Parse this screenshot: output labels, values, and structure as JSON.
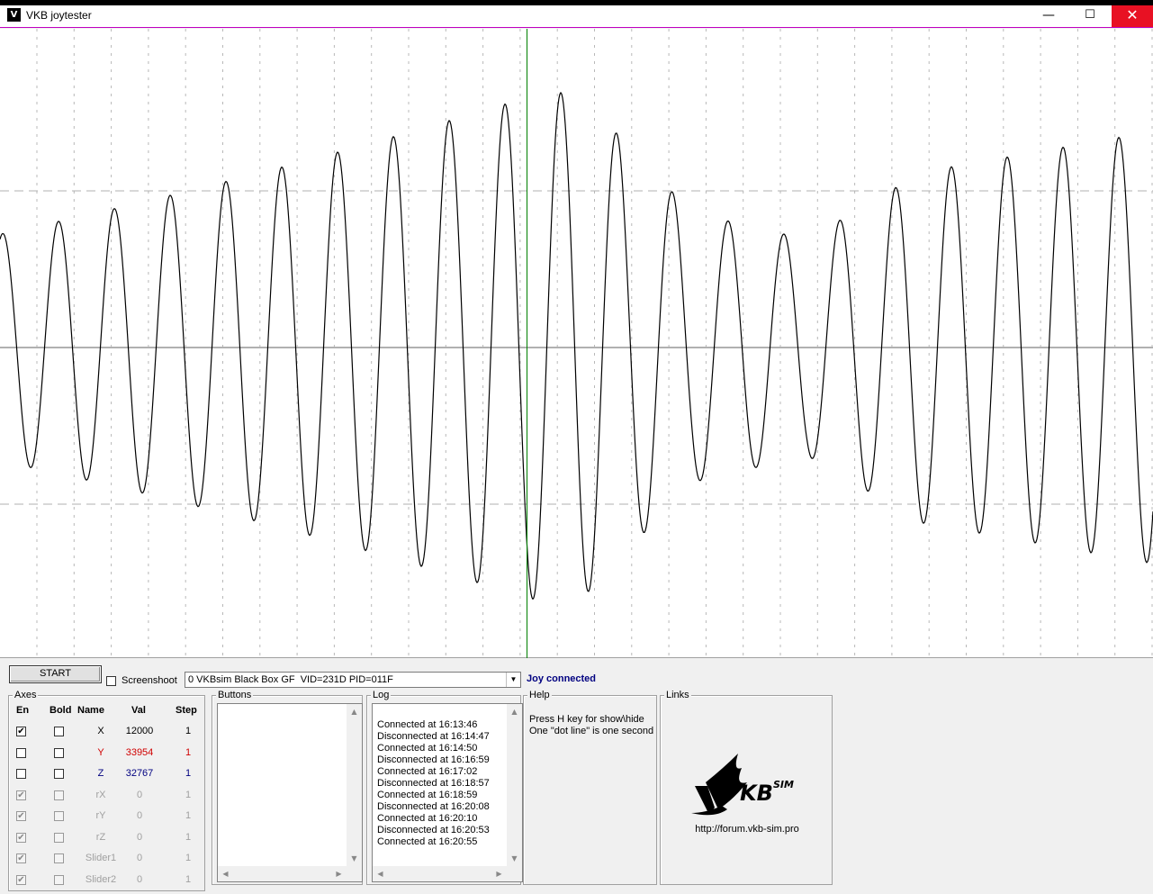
{
  "window": {
    "title": "VKB joytester",
    "icon_text": "V"
  },
  "titlebar": {
    "minimize_glyph": "—",
    "maximize_glyph": "☐",
    "close_glyph": "✕"
  },
  "toolbar": {
    "start_label": "START",
    "screenshoot_label": "Screenshoot",
    "screenshoot_checked": false,
    "device_selected": "0 VKBsim Black Box GF  VID=231D PID=011F",
    "status": "Joy connected"
  },
  "axes": {
    "title": "Axes",
    "headers": {
      "en": "En",
      "bold": "Bold",
      "name": "Name",
      "val": "Val",
      "step": "Step"
    },
    "rows": [
      {
        "en": true,
        "bold": false,
        "name": "X",
        "val": "12000",
        "step": "1",
        "color": "#000000",
        "disabled": false
      },
      {
        "en": false,
        "bold": false,
        "name": "Y",
        "val": "33954",
        "step": "1",
        "color": "#d00000",
        "disabled": false
      },
      {
        "en": false,
        "bold": false,
        "name": "Z",
        "val": "32767",
        "step": "1",
        "color": "#000080",
        "disabled": false
      },
      {
        "en": true,
        "bold": false,
        "name": "rX",
        "val": "0",
        "step": "1",
        "color": "#a0a0a0",
        "disabled": true
      },
      {
        "en": true,
        "bold": false,
        "name": "rY",
        "val": "0",
        "step": "1",
        "color": "#a0a0a0",
        "disabled": true
      },
      {
        "en": true,
        "bold": false,
        "name": "rZ",
        "val": "0",
        "step": "1",
        "color": "#a0a0a0",
        "disabled": true
      },
      {
        "en": true,
        "bold": false,
        "name": "Slider1",
        "val": "0",
        "step": "1",
        "color": "#a0a0a0",
        "disabled": true
      },
      {
        "en": true,
        "bold": false,
        "name": "Slider2",
        "val": "0",
        "step": "1",
        "color": "#a0a0a0",
        "disabled": true
      }
    ]
  },
  "buttons_panel": {
    "title": "Buttons"
  },
  "log": {
    "title": "Log",
    "entries": [
      "Connected at 16:13:46",
      "Disconnected at 16:14:47",
      "Connected at 16:14:50",
      "Disconnected at 16:16:59",
      "Connected at 16:17:02",
      "Disconnected at 16:18:57",
      "Connected at 16:18:59",
      "Disconnected at 16:20:08",
      "Connected at 16:20:10",
      "Disconnected at 16:20:53",
      "Connected at 16:20:55"
    ]
  },
  "help": {
    "title": "Help",
    "lines": [
      "Press H key for show\\hide",
      "One \"dot line\" is one second"
    ]
  },
  "links": {
    "title": "Links",
    "logo_text": "KB",
    "logo_sup": "SIM",
    "url": "http://forum.vkb-sim.pro"
  },
  "graph": {
    "cursor_fraction": 0.457,
    "x_samples": [
      {
        "t": 0.0,
        "a": 0.7
      },
      {
        "t": 0.5,
        "a": 0.95
      },
      {
        "t": 0.6,
        "a": 0.5
      },
      {
        "t": 0.7,
        "a": 0.4
      },
      {
        "t": 0.8,
        "a": 0.65
      },
      {
        "t": 1.0,
        "a": 0.8
      }
    ]
  },
  "colors": {
    "status": "#000080",
    "close_button": "#e81123",
    "trace": "#000000",
    "cursor": "#008000"
  }
}
